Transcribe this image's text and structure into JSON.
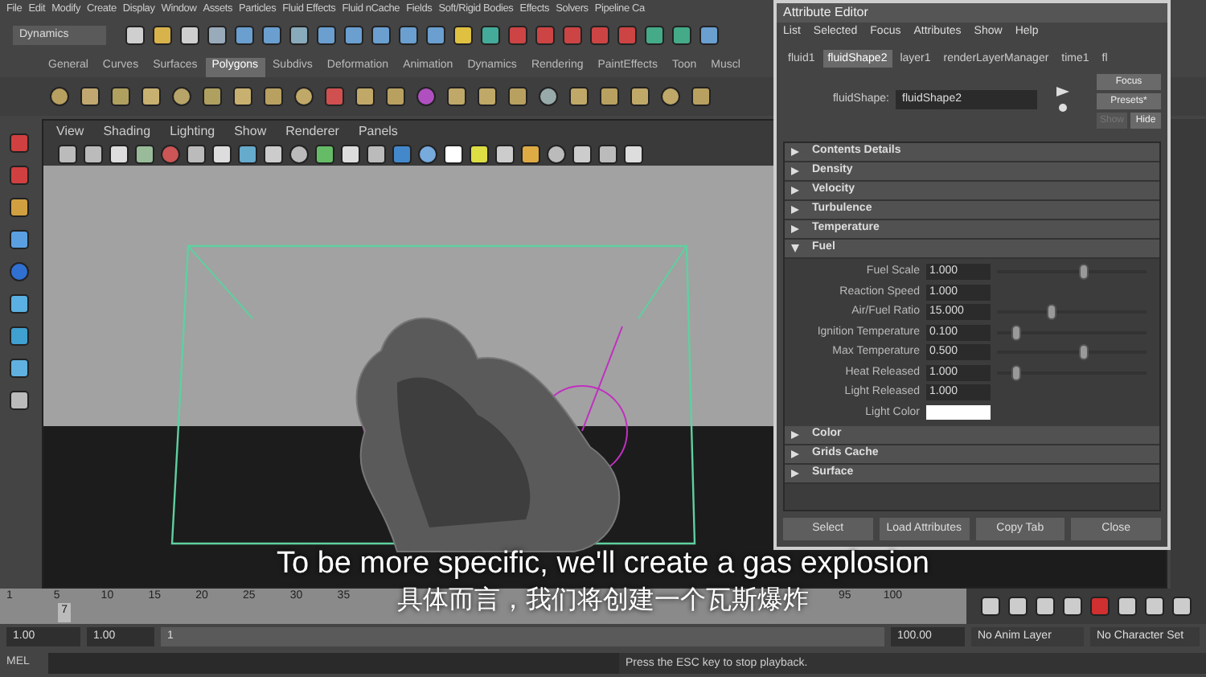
{
  "menu_bar": [
    "File",
    "Edit",
    "Modify",
    "Create",
    "Display",
    "Window",
    "Assets",
    "Particles",
    "Fluid Effects",
    "Fluid nCache",
    "Fields",
    "Soft/Rigid Bodies",
    "Effects",
    "Solvers",
    "Pipeline Ca"
  ],
  "status_line": {
    "menu_set": "Dynamics"
  },
  "shelf_tabs": [
    {
      "label": "General",
      "selected": false
    },
    {
      "label": "Curves",
      "selected": false
    },
    {
      "label": "Surfaces",
      "selected": false
    },
    {
      "label": "Polygons",
      "selected": true
    },
    {
      "label": "Subdivs",
      "selected": false
    },
    {
      "label": "Deformation",
      "selected": false
    },
    {
      "label": "Animation",
      "selected": false
    },
    {
      "label": "Dynamics",
      "selected": false
    },
    {
      "label": "Rendering",
      "selected": false
    },
    {
      "label": "PaintEffects",
      "selected": false
    },
    {
      "label": "Toon",
      "selected": false
    },
    {
      "label": "Muscl",
      "selected": false
    }
  ],
  "viewport": {
    "menu": [
      "View",
      "Shading",
      "Lighting",
      "Show",
      "Renderer",
      "Panels"
    ]
  },
  "attribute_editor": {
    "title": "Attribute Editor",
    "menu": [
      "List",
      "Selected",
      "Focus",
      "Attributes",
      "Show",
      "Help"
    ],
    "tabs": [
      {
        "label": "fluid1",
        "selected": false
      },
      {
        "label": "fluidShape2",
        "selected": true
      },
      {
        "label": "layer1",
        "selected": false
      },
      {
        "label": "renderLayerManager",
        "selected": false
      },
      {
        "label": "time1",
        "selected": false
      },
      {
        "label": "fl",
        "selected": false
      }
    ],
    "node_label": "fluidShape:",
    "node_name": "fluidShape2",
    "side_buttons": [
      {
        "label": "Focus",
        "disabled": false
      },
      {
        "label": "Presets*",
        "disabled": false
      },
      {
        "label": "Show",
        "disabled": true
      },
      {
        "label": "Hide",
        "disabled": false
      }
    ],
    "sections": [
      {
        "label": "Contents Details",
        "expanded": false
      },
      {
        "label": "Density",
        "expanded": false
      },
      {
        "label": "Velocity",
        "expanded": false
      },
      {
        "label": "Turbulence",
        "expanded": false
      },
      {
        "label": "Temperature",
        "expanded": false
      },
      {
        "label": "Fuel",
        "expanded": true,
        "attributes": [
          {
            "label": "Fuel Scale",
            "kind": "slider",
            "value": "1.000",
            "level": 0.55
          },
          {
            "label": "Reaction Speed",
            "kind": "number",
            "value": "1.000"
          },
          {
            "label": "Air/Fuel Ratio",
            "kind": "slider",
            "value": "15.000",
            "level": 0.33
          },
          {
            "label": "Ignition Temperature",
            "kind": "slider",
            "value": "0.100",
            "level": 0.1
          },
          {
            "label": "Max Temperature",
            "kind": "slider",
            "value": "0.500",
            "level": 0.55
          },
          {
            "label": "Heat Released",
            "kind": "slider",
            "value": "1.000",
            "level": 0.1
          },
          {
            "label": "Light Released",
            "kind": "number",
            "value": "1.000"
          },
          {
            "label": "Light Color",
            "kind": "swatch"
          }
        ]
      },
      {
        "label": "Color",
        "expanded": false
      },
      {
        "label": "Grids Cache",
        "expanded": false
      },
      {
        "label": "Surface",
        "expanded": false
      }
    ],
    "buttons": [
      "Select",
      "Load Attributes",
      "Copy Tab",
      "Close"
    ]
  },
  "time_slider": {
    "ticks": [
      "1",
      "5",
      "10",
      "15",
      "20",
      "25",
      "30",
      "35"
    ],
    "end_ticks": [
      "95",
      "100"
    ],
    "current": "7",
    "level": 0.06
  },
  "range_slider": {
    "start": "1.00",
    "range_start": "1.00",
    "range_handle": "1",
    "level": 1,
    "end": "100.00",
    "anim_layer": "No Anim Layer",
    "character_set": "No Character Set"
  },
  "command_line": {
    "language": "MEL",
    "help_line": "Press the ESC key to stop playback."
  },
  "subtitles": [
    "To be more specific, we'll create a gas explosion",
    "具体而言，我们将创建一个瓦斯爆炸"
  ]
}
